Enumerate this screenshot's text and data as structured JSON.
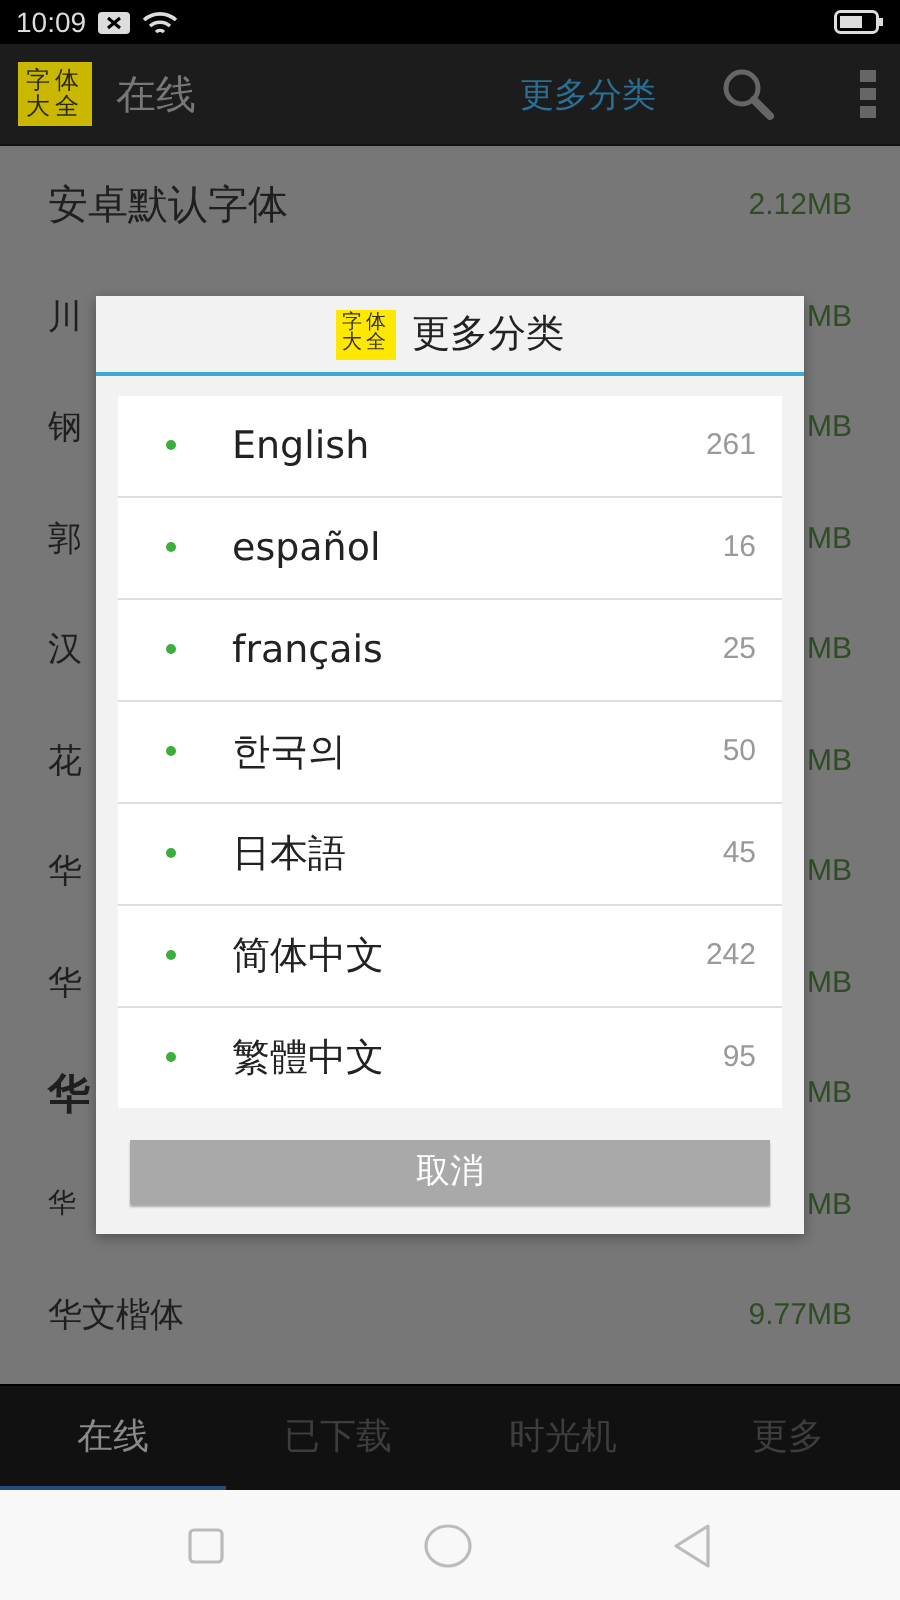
{
  "status_bar": {
    "time": "10:09"
  },
  "app_bar": {
    "logo": "字体大全",
    "title": "在线",
    "action": "更多分类"
  },
  "fonts": [
    {
      "name": "安卓默认字体",
      "size": "2.12MB"
    },
    {
      "name": "川",
      "size": "MB"
    },
    {
      "name": "钢",
      "size": "MB"
    },
    {
      "name": "郭",
      "size": "MB"
    },
    {
      "name": "汉",
      "size": "MB"
    },
    {
      "name": "花",
      "size": "MB"
    },
    {
      "name": "华",
      "size": "MB"
    },
    {
      "name": "华",
      "size": "MB"
    },
    {
      "name": "华",
      "size": "MB"
    },
    {
      "name": "华",
      "size": "MB"
    },
    {
      "name": "华文楷体",
      "size": "9.77MB"
    }
  ],
  "dialog": {
    "logo": "字体大全",
    "title": "更多分类",
    "items": [
      {
        "label": "English",
        "count": "261"
      },
      {
        "label": "español",
        "count": "16"
      },
      {
        "label": "français",
        "count": "25"
      },
      {
        "label": "한국의",
        "count": "50"
      },
      {
        "label": "日本語",
        "count": "45"
      },
      {
        "label": "简体中文",
        "count": "242"
      },
      {
        "label": "繁體中文",
        "count": "95"
      }
    ],
    "cancel": "取消"
  },
  "tabs": [
    {
      "label": "在线",
      "selected": true
    },
    {
      "label": "已下载",
      "selected": false
    },
    {
      "label": "时光机",
      "selected": false
    },
    {
      "label": "更多",
      "selected": false
    }
  ]
}
